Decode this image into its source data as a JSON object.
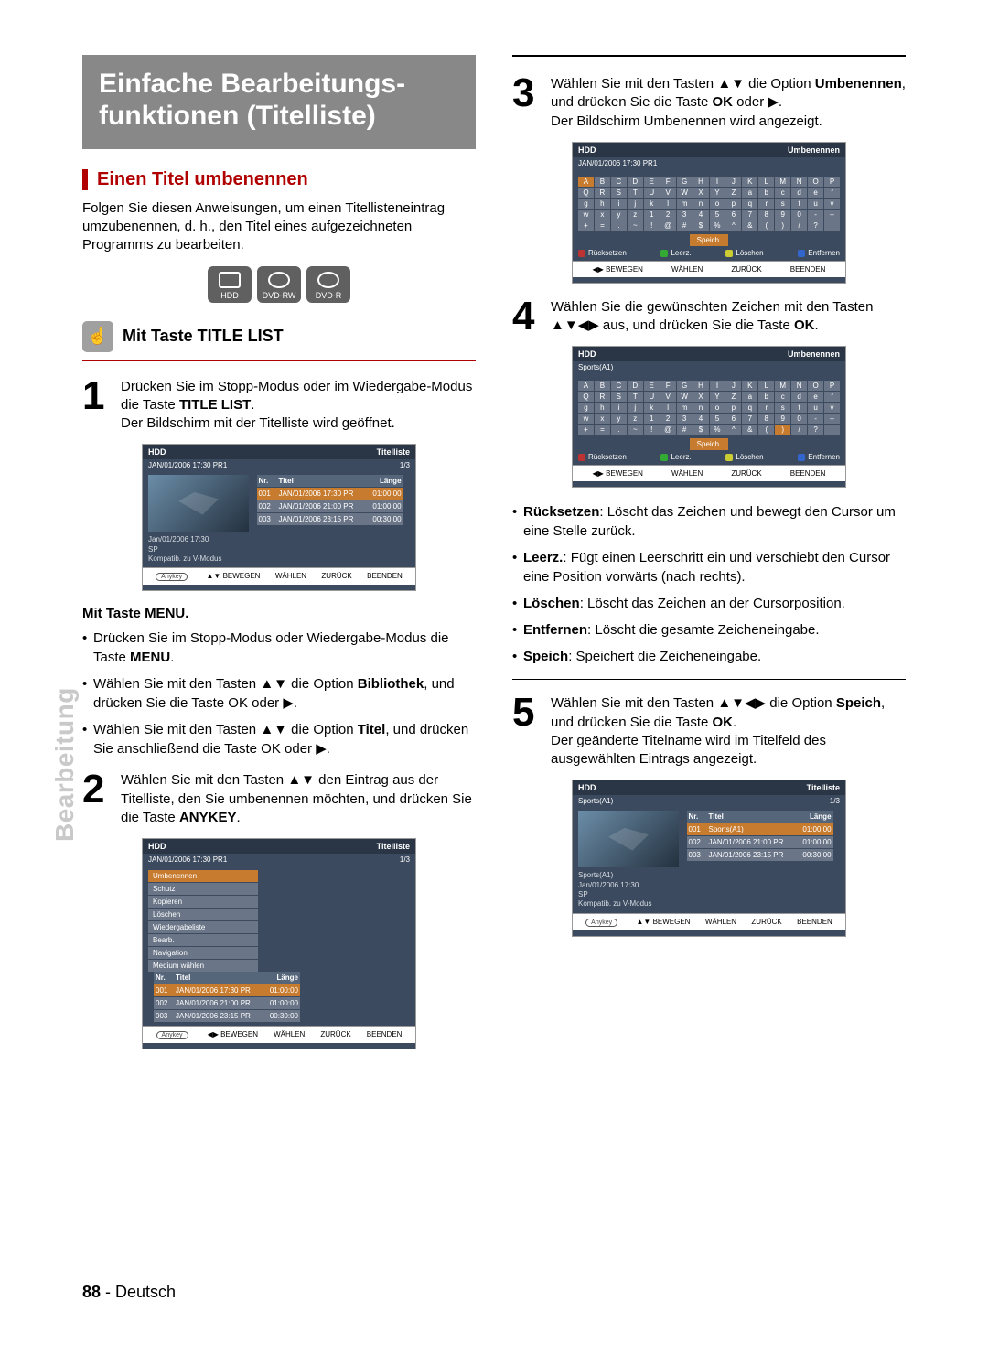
{
  "sideLabel": "Bearbeitung",
  "title": "Einfache Bearbeitungs-\nfunktionen (Titelliste)",
  "subheading": "Einen Titel umbenennen",
  "intro": "Folgen Sie diesen Anweisungen, um einen Titellisteneintrag umzubenennen, d. h., den Titel eines aufgezeichneten Programms zu bearbeiten.",
  "mediaIcons": [
    "HDD",
    "DVD-RW",
    "DVD-R"
  ],
  "handSection": "Mit Taste TITLE LIST",
  "step1": {
    "num": "1",
    "t1": "Drücken Sie im Stopp-Modus oder im Wiedergabe-Modus die Taste ",
    "b1": "TITLE LIST",
    "t2": ".\nDer Bildschirm mit der Titelliste wird geöffnet."
  },
  "menuHead": "Mit Taste MENU.",
  "menuBullets": [
    {
      "pre": "Drücken Sie im Stopp-Modus oder Wiedergabe-Modus die Taste ",
      "b": "MENU",
      "post": "."
    },
    {
      "pre": "Wählen Sie mit den Tasten ▲▼ die Option ",
      "b": "Bibliothek",
      "post": ", und drücken Sie die Taste OK oder ▶."
    },
    {
      "pre": "Wählen Sie mit den Tasten ▲▼ die Option ",
      "b": "Titel",
      "post": ", und drücken Sie anschließend die Taste OK oder ▶."
    }
  ],
  "step2": {
    "num": "2",
    "t1": "Wählen Sie mit den Tasten ▲▼ den Eintrag aus der Titelliste, den Sie umbenennen möchten, und drücken Sie die Taste ",
    "b1": "ANYKEY",
    "t2": "."
  },
  "step3": {
    "num": "3",
    "t1": "Wählen Sie mit den Tasten ▲▼ die Option ",
    "b1": "Umbenennen",
    "t2": ", und drücken Sie die Taste ",
    "b2": "OK",
    "t3": " oder ▶.\nDer Bildschirm Umbenennen wird angezeigt."
  },
  "step4": {
    "num": "4",
    "t1": "Wählen Sie die gewünschten Zeichen mit den Tasten ▲▼◀▶ aus, und drücken Sie die Taste ",
    "b1": "OK",
    "t2": "."
  },
  "defs": [
    {
      "b": "Rücksetzen",
      "t": ": Löscht das Zeichen und bewegt den Cursor um eine Stelle zurück."
    },
    {
      "b": "Leerz.",
      "t": ": Fügt einen Leerschritt ein und verschiebt den Cursor eine Position vorwärts (nach rechts)."
    },
    {
      "b": "Löschen",
      "t": ": Löscht das Zeichen an der Cursorposition."
    },
    {
      "b": "Entfernen",
      "t": ": Löscht die gesamte Zeicheneingabe."
    },
    {
      "b": "Speich",
      "t": ": Speichert die Zeicheneingabe."
    }
  ],
  "step5": {
    "num": "5",
    "t1": "Wählen Sie mit den Tasten ▲▼◀▶ die Option ",
    "b1": "Speich",
    "t2": ", und drücken Sie die Taste ",
    "b2": "OK",
    "t3": ".\nDer geänderte Titelname wird im Titelfeld des ausgewählten Eintrags angezeigt."
  },
  "pageNum": "88",
  "pageLang": "Deutsch",
  "screenCommon": {
    "hdd": "HDD",
    "titleList": "Titelliste",
    "rename": "Umbenennen",
    "dateHdr": "JAN/01/2006 17:30 PR1",
    "counter": "1/3",
    "cols": {
      "nr": "Nr.",
      "titel": "Titel",
      "lange": "Länge"
    },
    "rows": [
      {
        "nr": "001",
        "t": "JAN/01/2006 17:30 PR",
        "l": "01:00:00"
      },
      {
        "nr": "002",
        "t": "JAN/01/2006 21:00 PR",
        "l": "01:00:00"
      },
      {
        "nr": "003",
        "t": "JAN/01/2006 23:15 PR",
        "l": "00:30:00"
      }
    ],
    "rowsSports": [
      {
        "nr": "001",
        "t": "Sports(A1)",
        "l": "01:00:00"
      },
      {
        "nr": "002",
        "t": "JAN/01/2006 21:00 PR",
        "l": "01:00:00"
      },
      {
        "nr": "003",
        "t": "JAN/01/2006 23:15 PR",
        "l": "00:30:00"
      }
    ],
    "infoLines": [
      "Jan/01/2006 17:30",
      "SP",
      "Kompatib. zu V-Modus"
    ],
    "infoLinesSports": [
      "Sports(A1)",
      "Jan/01/2006 17:30",
      "SP",
      "Kompatib. zu V-Modus"
    ],
    "hints": {
      "anykey": "Anykey",
      "bewegen": "BEWEGEN",
      "wahlen": "WÄHLEN",
      "zuruck": "ZURÜCK",
      "beenden": "BEENDEN"
    },
    "contextMenu": [
      "Umbenennen",
      "Schutz",
      "Kopieren",
      "Löschen",
      "Wiedergabeliste",
      "Bearb.",
      "Navigation",
      "Medium wählen"
    ],
    "kbRow1": [
      "A",
      "B",
      "C",
      "D",
      "E",
      "F",
      "G",
      "H",
      "I",
      "J",
      "K",
      "L",
      "M",
      "N",
      "O",
      "P"
    ],
    "kbRow2": [
      "Q",
      "R",
      "S",
      "T",
      "U",
      "V",
      "W",
      "X",
      "Y",
      "Z",
      "a",
      "b",
      "c",
      "d",
      "e",
      "f"
    ],
    "kbRow3": [
      "g",
      "h",
      "i",
      "j",
      "k",
      "l",
      "m",
      "n",
      "o",
      "p",
      "q",
      "r",
      "s",
      "t",
      "u",
      "v"
    ],
    "kbRow4": [
      "w",
      "x",
      "y",
      "z",
      "1",
      "2",
      "3",
      "4",
      "5",
      "6",
      "7",
      "8",
      "9",
      "0",
      "-",
      "–"
    ],
    "kbRow5": [
      "+",
      "=",
      ".",
      "~",
      "!",
      "@",
      "#",
      "$",
      "%",
      "^",
      "&",
      "(",
      ")",
      "/",
      "?",
      "|"
    ],
    "kbSave": "Speich.",
    "kbActions": {
      "ruck": "Rücksetzen",
      "leerz": "Leerz.",
      "losch": "Löschen",
      "entf": "Entfernen"
    },
    "sportsLabel": "Sports(A1)"
  }
}
